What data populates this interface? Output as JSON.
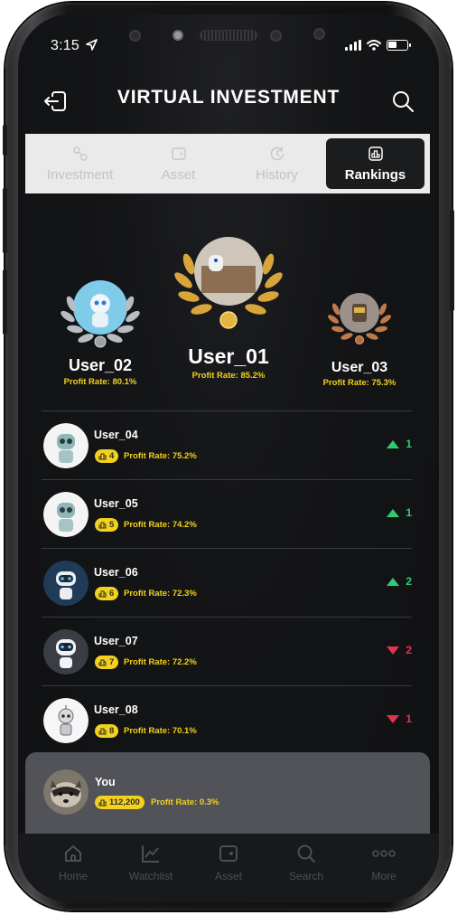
{
  "status_bar": {
    "time": "3:15"
  },
  "header": {
    "title": "VIRTUAL INVESTMENT"
  },
  "tabs": [
    {
      "label": "Investment",
      "icon": "investment-icon",
      "active": false
    },
    {
      "label": "Asset",
      "icon": "wallet-icon",
      "active": false
    },
    {
      "label": "History",
      "icon": "history-icon",
      "active": false
    },
    {
      "label": "Rankings",
      "icon": "rankings-icon",
      "active": true
    }
  ],
  "podium": {
    "first": {
      "name": "User_01",
      "rate": "Profit Rate: 85.2%"
    },
    "second": {
      "name": "User_02",
      "rate": "Profit Rate: 80.1%"
    },
    "third": {
      "name": "User_03",
      "rate": "Profit Rate: 75.3%"
    }
  },
  "rankings": [
    {
      "name": "User_04",
      "rank": "4",
      "rate": "Profit Rate: 75.2%",
      "direction": "up",
      "change": "1"
    },
    {
      "name": "User_05",
      "rank": "5",
      "rate": "Profit Rate: 74.2%",
      "direction": "up",
      "change": "1"
    },
    {
      "name": "User_06",
      "rank": "6",
      "rate": "Profit Rate: 72.3%",
      "direction": "up",
      "change": "2"
    },
    {
      "name": "User_07",
      "rank": "7",
      "rate": "Profit Rate: 72.2%",
      "direction": "down",
      "change": "2"
    },
    {
      "name": "User_08",
      "rank": "8",
      "rate": "Profit Rate: 70.1%",
      "direction": "down",
      "change": "1"
    }
  ],
  "you": {
    "name": "You",
    "rank": "112,200",
    "rate": "Profit Rate: 0.3%"
  },
  "bottom_nav": [
    {
      "label": "Home",
      "icon": "home-icon"
    },
    {
      "label": "Watchlist",
      "icon": "chart-icon"
    },
    {
      "label": "Asset",
      "icon": "wallet-icon"
    },
    {
      "label": "Search",
      "icon": "search-icon"
    },
    {
      "label": "More",
      "icon": "more-icon"
    }
  ],
  "colors": {
    "accent_yellow": "#f2d21c",
    "up_green": "#2ecc71",
    "down_red": "#e0344f",
    "background": "#141517",
    "you_card": "#525358"
  }
}
